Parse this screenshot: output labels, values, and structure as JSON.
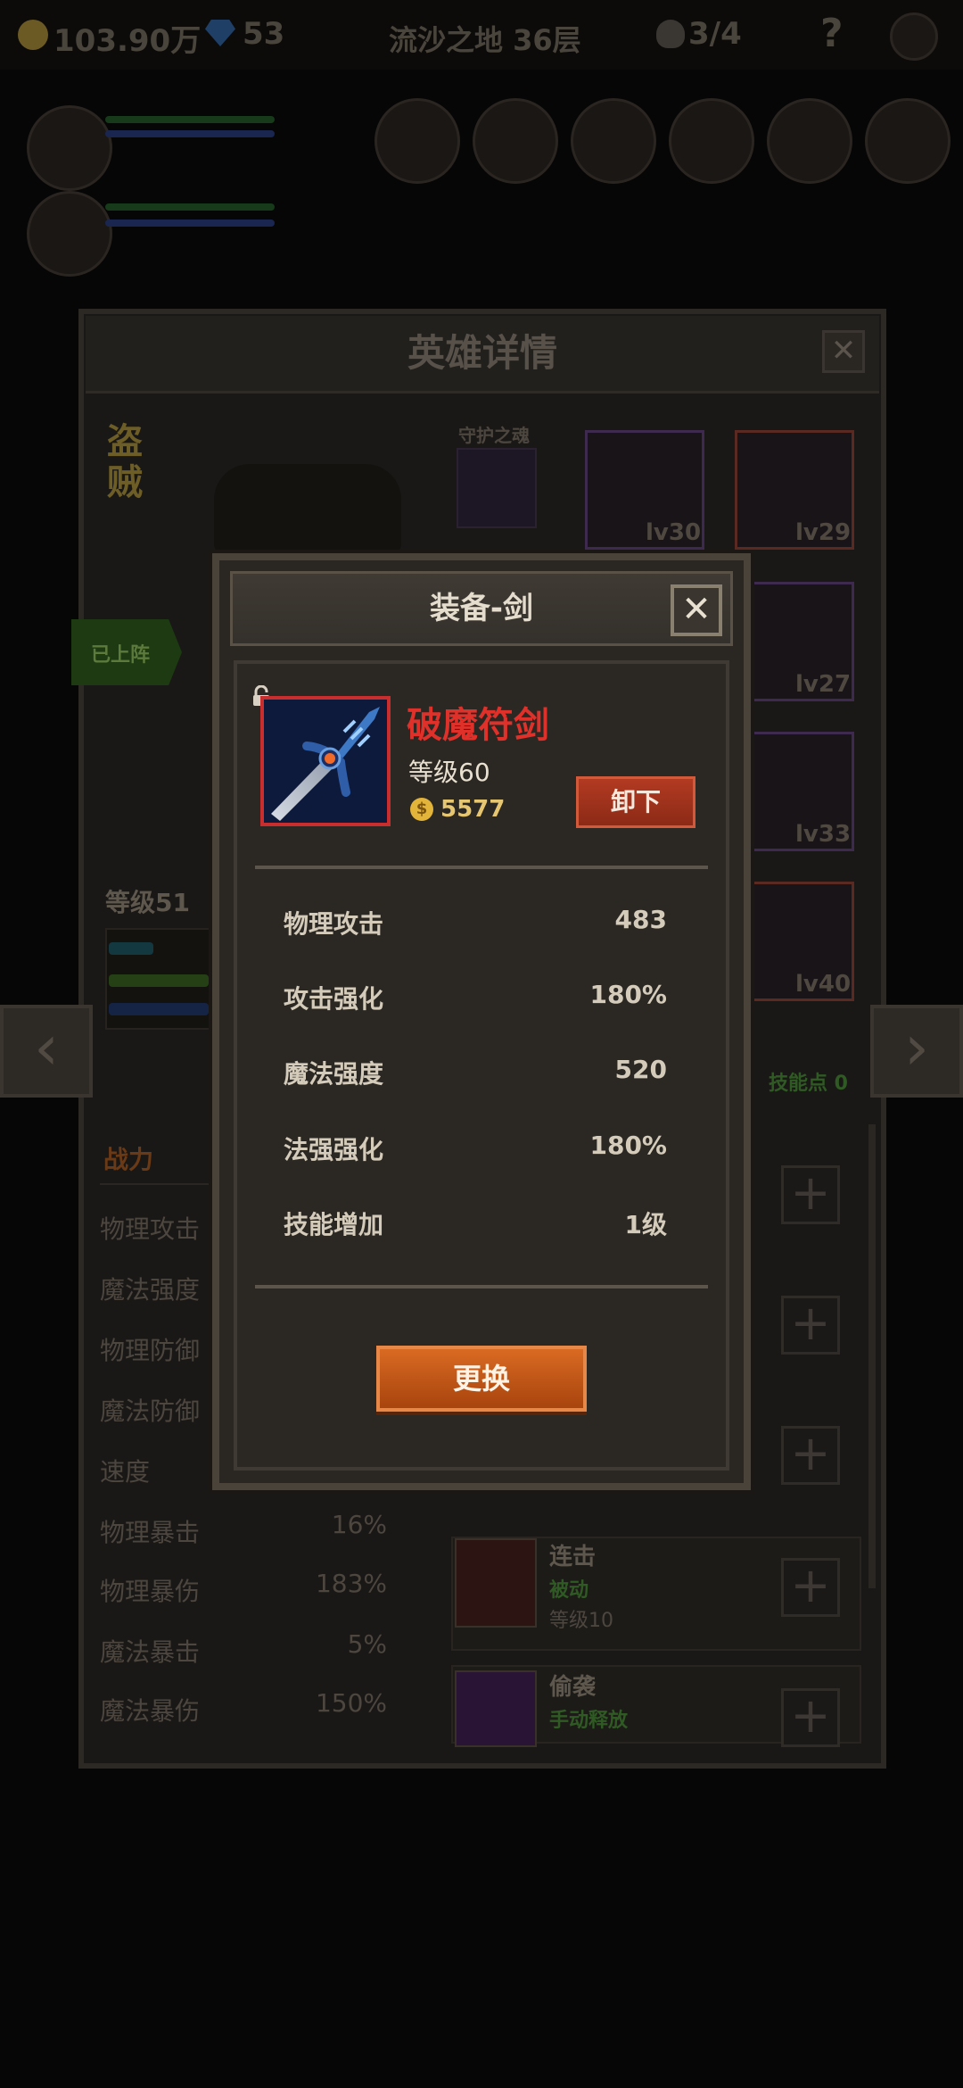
{
  "topbar": {
    "gold": "103.90万",
    "gems": "53",
    "location": "流沙之地 36层",
    "skulls": "3/4",
    "help": "?"
  },
  "hero_panel": {
    "title": "英雄详情",
    "close": "✕",
    "class_name": "盗贼",
    "guardian_label": "守护之魂",
    "deployed_tag": "已上阵",
    "hero_level": "等级51",
    "combat_tab": "战力",
    "skill_points": "技能点 0",
    "equipment_slots": [
      {
        "level": "lv30"
      },
      {
        "level": "lv29"
      },
      {
        "level": "lv27"
      },
      {
        "level": "lv33"
      },
      {
        "level": "lv40"
      }
    ],
    "stats": [
      {
        "label": "物理攻击",
        "value": ""
      },
      {
        "label": "魔法强度",
        "value": ""
      },
      {
        "label": "物理防御",
        "value": ""
      },
      {
        "label": "魔法防御",
        "value": ""
      },
      {
        "label": "速度",
        "value": ""
      },
      {
        "label": "物理暴击",
        "value": "16%"
      },
      {
        "label": "物理暴伤",
        "value": "183%"
      },
      {
        "label": "魔法暴击",
        "value": "5%"
      },
      {
        "label": "魔法暴伤",
        "value": "150%"
      }
    ],
    "skills": [
      {
        "name": "连击",
        "type": "被动",
        "level": "等级10"
      },
      {
        "name": "偷袭",
        "type": "手动释放",
        "level": ""
      }
    ],
    "arrow_left": "‹",
    "arrow_right": "›"
  },
  "modal": {
    "title": "装备-剑",
    "close": "✕",
    "item_name": "破魔符剑",
    "item_level": "等级60",
    "price": "5577",
    "coin_symbol": "$",
    "unequip_label": "卸下",
    "replace_label": "更换",
    "stats": [
      {
        "label": "物理攻击",
        "value": "483"
      },
      {
        "label": "攻击强化",
        "value": "180%"
      },
      {
        "label": "魔法强度",
        "value": "520"
      },
      {
        "label": "法强强化",
        "value": "180%"
      },
      {
        "label": "技能增加",
        "value": "1级"
      }
    ]
  }
}
